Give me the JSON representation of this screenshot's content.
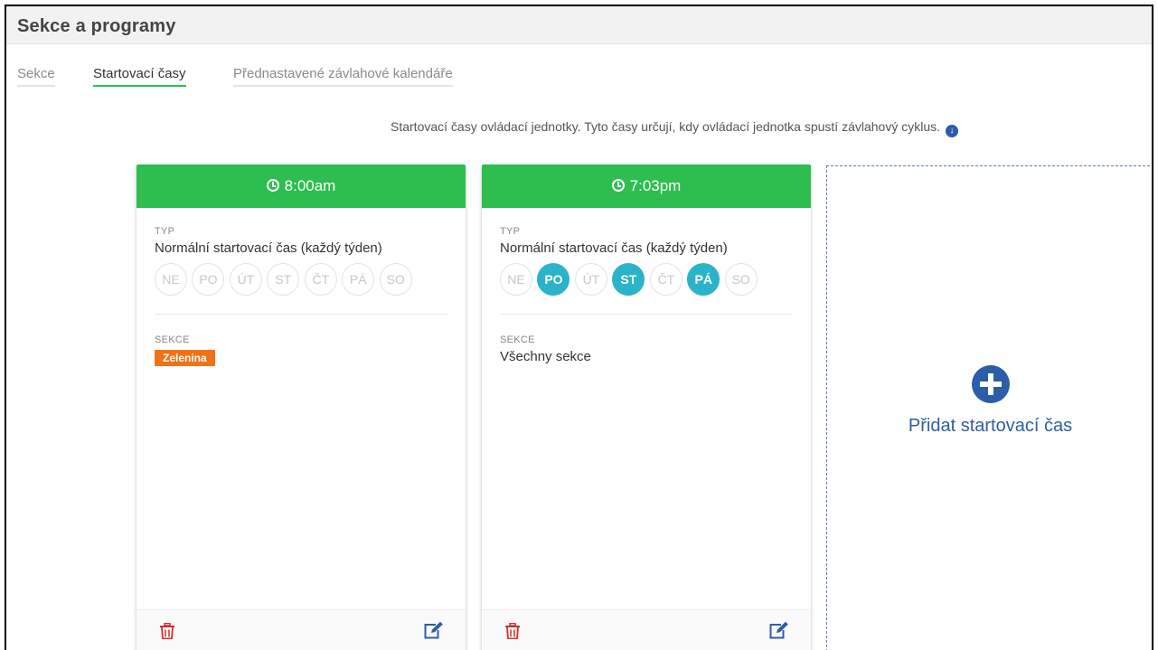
{
  "header": {
    "title": "Sekce a programy"
  },
  "tabs": [
    {
      "label": "Sekce",
      "active": false
    },
    {
      "label": "Startovací časy",
      "active": true
    },
    {
      "label": "Přednastavené závlahové kalendáře",
      "active": false
    }
  ],
  "intro": {
    "text": "Startovací časy ovládací jednotky. Tyto časy určují, kdy ovládací jednotka spustí závlahový cyklus."
  },
  "day_labels": [
    "NE",
    "PO",
    "ÚT",
    "ST",
    "ČT",
    "PÁ",
    "SO"
  ],
  "cards": [
    {
      "time": "8:00am",
      "type_label": "TYP",
      "type_value": "Normální startovací čas (každý týden)",
      "active_days": [],
      "sections_label": "SEKCE",
      "section_badge": "Zelenina"
    },
    {
      "time": "7:03pm",
      "type_label": "TYP",
      "type_value": "Normální startovací čas (každý týden)",
      "active_days": [
        "PO",
        "ST",
        "PÁ"
      ],
      "sections_label": "SEKCE",
      "sections_value": "Všechny sekce"
    }
  ],
  "add_card": {
    "label": "Přidat startovací čas"
  },
  "colors": {
    "accent_green": "#2dbe4f",
    "day_active": "#2bb3c9",
    "badge_orange": "#f27116",
    "link_blue": "#2e5ea8",
    "delete_red": "#d0312d"
  },
  "icons": {
    "clock": "clock-icon",
    "trash": "trash-icon",
    "edit": "edit-icon",
    "plus": "plus-circle-icon",
    "info": "arrow-down-circle-icon"
  }
}
